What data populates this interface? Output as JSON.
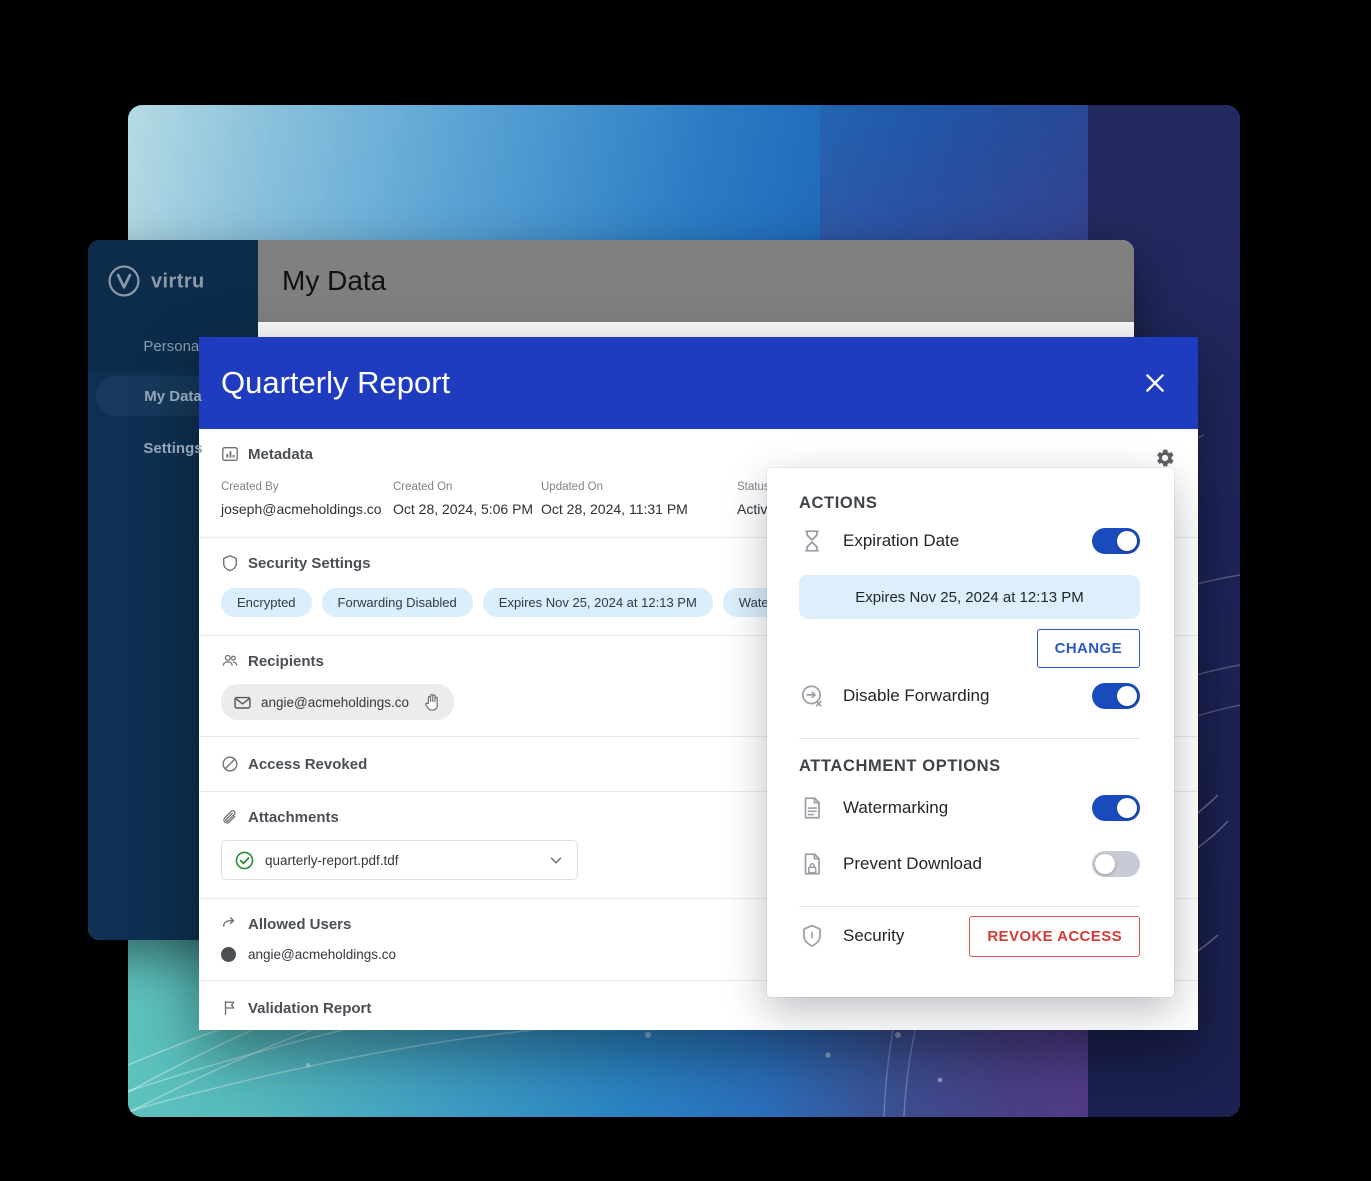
{
  "app": {
    "brand": "virtru",
    "topbar_title": "My Data",
    "sidebar": {
      "section_label": "Personal",
      "items": [
        {
          "label": "My Data",
          "active": true
        },
        {
          "label": "Settings",
          "active": false
        }
      ]
    }
  },
  "modal": {
    "title": "Quarterly Report",
    "close_icon": "close-icon",
    "gear_icon": "gear-icon",
    "sections": {
      "metadata": {
        "heading": "Metadata",
        "icon": "chart-box-icon",
        "fields": [
          {
            "label": "Created By",
            "value": "joseph@acmeholdings.co"
          },
          {
            "label": "Created On",
            "value": "Oct 28, 2024, 5:06 PM"
          },
          {
            "label": "Updated On",
            "value": "Oct 28, 2024, 11:31 PM"
          },
          {
            "label": "Status",
            "value": "Active"
          }
        ]
      },
      "security_settings": {
        "heading": "Security Settings",
        "icon": "shield-icon",
        "chips": [
          "Encrypted",
          "Forwarding Disabled",
          "Expires Nov 25, 2024 at 12:13 PM",
          "Watermarked"
        ]
      },
      "recipients": {
        "heading": "Recipients",
        "icon": "people-icon",
        "items": [
          "angie@acmeholdings.co"
        ],
        "cursor_icon": "hand-cursor-icon"
      },
      "access_revoked": {
        "heading": "Access Revoked",
        "icon": "prohibited-icon"
      },
      "attachments": {
        "heading": "Attachments",
        "icon": "paperclip-icon",
        "file_name": "quarterly-report.pdf.tdf",
        "status_icon": "check-circle-icon",
        "expand_icon": "chevron-down-icon"
      },
      "allowed_users": {
        "heading": "Allowed Users",
        "icon": "arrow-forward-icon",
        "items": [
          "angie@acmeholdings.co"
        ]
      },
      "validation_report": {
        "heading": "Validation Report",
        "icon": "flag-icon"
      }
    }
  },
  "actions_panel": {
    "heading": "ACTIONS",
    "expiration": {
      "label": "Expiration Date",
      "icon": "hourglass-icon",
      "enabled": true,
      "value_text": "Expires Nov 25, 2024 at 12:13 PM",
      "change_label": "CHANGE"
    },
    "disable_forwarding": {
      "label": "Disable Forwarding",
      "icon": "forward-disabled-icon",
      "enabled": true
    },
    "attachment_options": {
      "heading": "ATTACHMENT OPTIONS",
      "watermarking": {
        "label": "Watermarking",
        "icon": "document-lines-icon",
        "enabled": true
      },
      "prevent_download": {
        "label": "Prevent Download",
        "icon": "document-lock-icon",
        "enabled": false
      }
    },
    "security": {
      "label": "Security",
      "icon": "shield-lock-icon",
      "revoke_label": "REVOKE ACCESS"
    }
  },
  "colors": {
    "modal_header": "#1f3bbf",
    "toggle_on": "#1a4bbd",
    "toggle_off": "#c7cbd6",
    "chip_bg": "#dbeefb",
    "revoke_red": "#d23b36",
    "change_blue": "#2b59c8",
    "sidebar_bg": "#0e3052",
    "topbar_bg": "#808080"
  }
}
